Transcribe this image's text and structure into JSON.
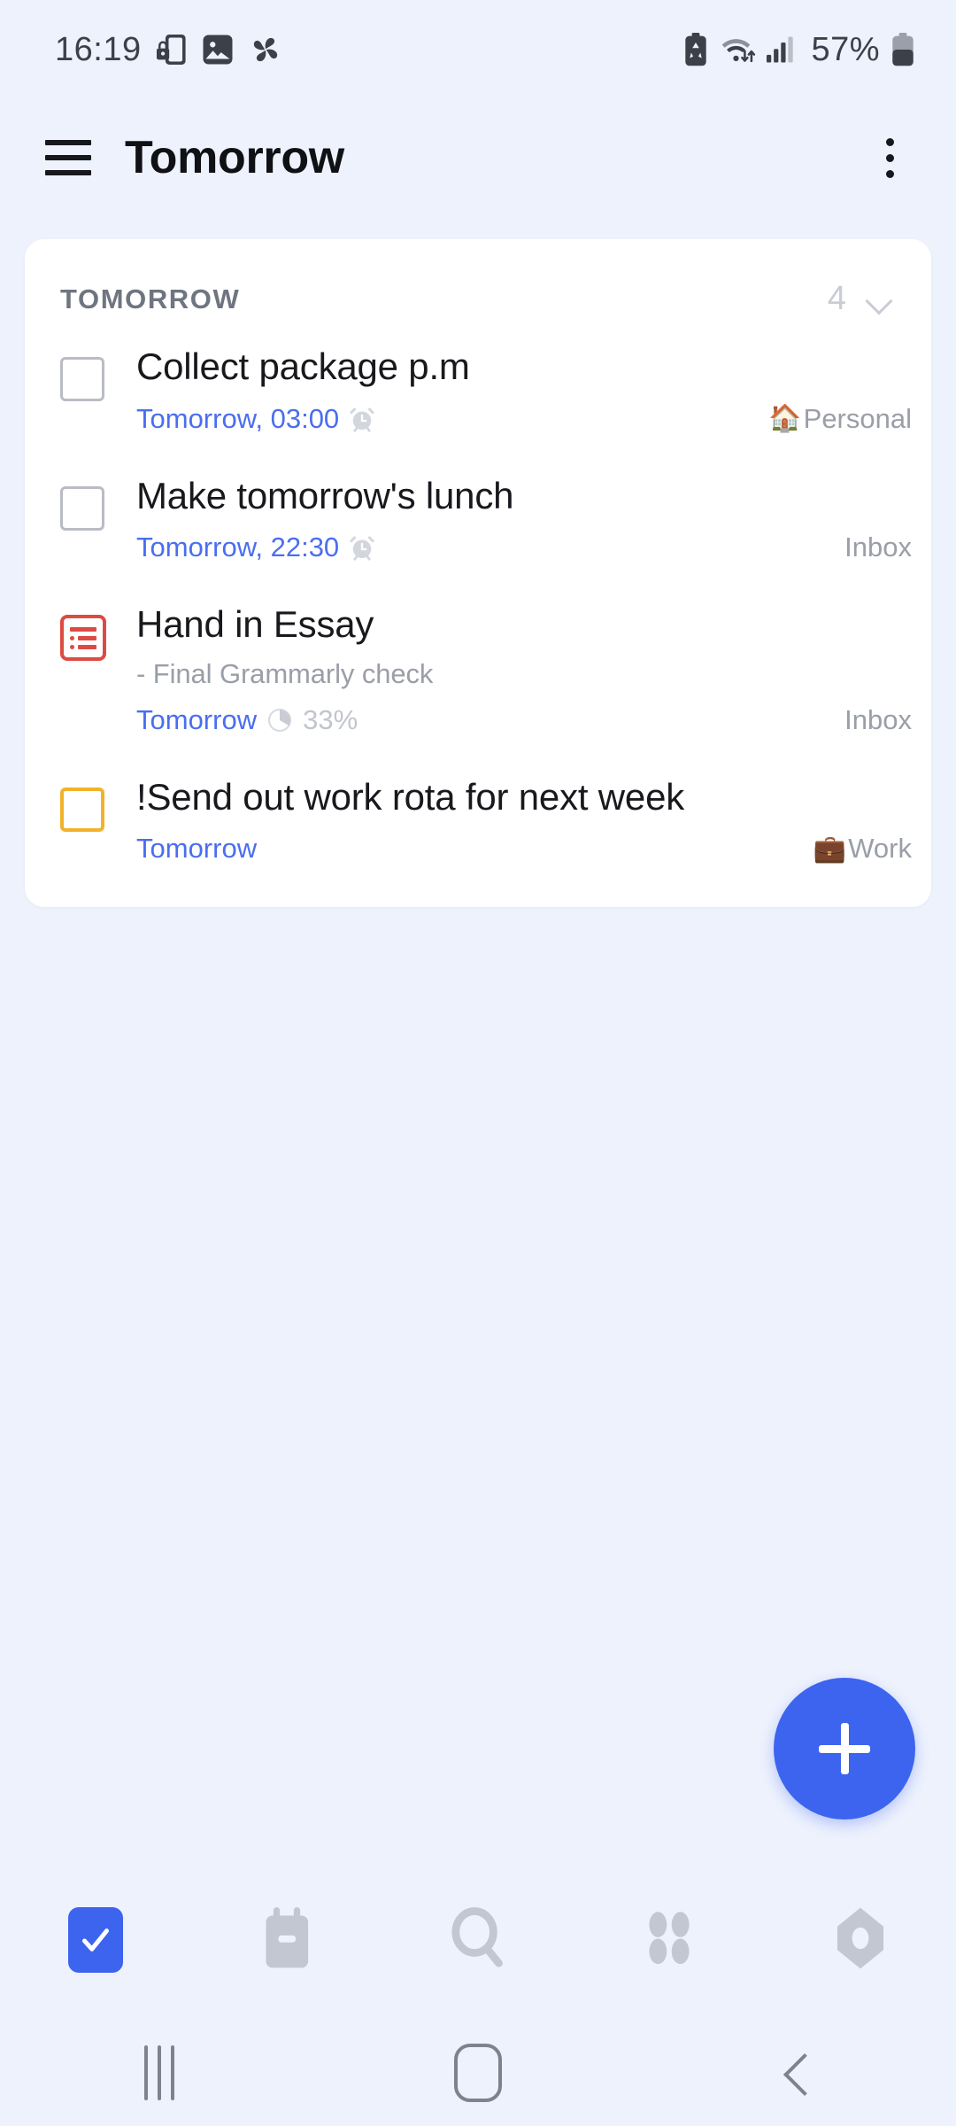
{
  "status_bar": {
    "time": "16:19",
    "battery_percent": "57%",
    "left_icons": [
      "phone-lock-icon",
      "image-icon",
      "pinwheel-icon"
    ],
    "right_icons": [
      "battery-saver-icon",
      "wifi-icon",
      "signal-bars-icon",
      "battery-icon"
    ]
  },
  "app_bar": {
    "menu_icon": "hamburger-menu-icon",
    "title": "Tomorrow",
    "overflow_icon": "more-vertical-icon"
  },
  "section": {
    "title": "TOMORROW",
    "count": "4",
    "collapse_icon": "chevron-down-icon"
  },
  "tasks": [
    {
      "marker": "checkbox",
      "marker_color": "#b9bcc4",
      "title": "Collect package p.m",
      "note": "",
      "date": "Tomorrow, 03:00",
      "reminder_icon": "alarm-clock-icon",
      "progress": "",
      "list_emoji": "🏠",
      "list_name": "Personal"
    },
    {
      "marker": "checkbox",
      "marker_color": "#b9bcc4",
      "title": "Make tomorrow's lunch",
      "note": "",
      "date": "Tomorrow, 22:30",
      "reminder_icon": "alarm-clock-icon",
      "progress": "",
      "list_emoji": "",
      "list_name": "Inbox"
    },
    {
      "marker": "subtask",
      "marker_color": "#dc4b43",
      "title": "Hand in Essay",
      "note": "- Final Grammarly check",
      "date": "Tomorrow",
      "reminder_icon": "",
      "progress": "33%",
      "list_emoji": "",
      "list_name": "Inbox"
    },
    {
      "marker": "checkbox",
      "marker_color": "#f2b229",
      "title": "!Send out work rota for next week",
      "note": "",
      "date": "Tomorrow",
      "reminder_icon": "",
      "progress": "",
      "list_emoji": "💼",
      "list_name": "Work"
    }
  ],
  "fab": {
    "icon": "plus-icon",
    "color": "#3c64ef"
  },
  "bottom_nav": {
    "active_color": "#3c64ef",
    "inactive_color": "#c3c7d1",
    "items": [
      {
        "icon": "tasks-check-icon",
        "active": true
      },
      {
        "icon": "calendar-icon",
        "active": false
      },
      {
        "icon": "search-icon",
        "active": false
      },
      {
        "icon": "grid-apps-icon",
        "active": false
      },
      {
        "icon": "settings-hexagon-icon",
        "active": false
      }
    ]
  },
  "system_nav": {
    "items": [
      {
        "icon": "recents-icon"
      },
      {
        "icon": "home-icon"
      },
      {
        "icon": "back-icon"
      }
    ]
  }
}
